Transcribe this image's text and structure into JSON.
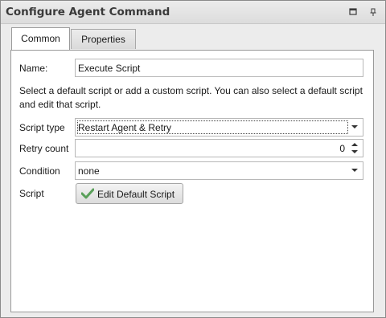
{
  "window": {
    "title": "Configure Agent Command",
    "restore_icon": "restore-icon",
    "pin_icon": "pin-icon"
  },
  "tabs": [
    {
      "label": "Common",
      "active": true
    },
    {
      "label": "Properties",
      "active": false
    }
  ],
  "form": {
    "name_label": "Name:",
    "name_value": "Execute Script",
    "description": "Select a default script or add a custom script. You can also select a default script and edit that script.",
    "script_type_label": "Script type",
    "script_type_value": "Restart Agent & Retry",
    "retry_count_label": "Retry count",
    "retry_count_value": "0",
    "condition_label": "Condition",
    "condition_value": "none",
    "script_label": "Script",
    "edit_button_label": "Edit Default Script",
    "edit_button_icon": "checkmark-icon"
  },
  "colors": {
    "checkmark": "#5aa05a"
  }
}
